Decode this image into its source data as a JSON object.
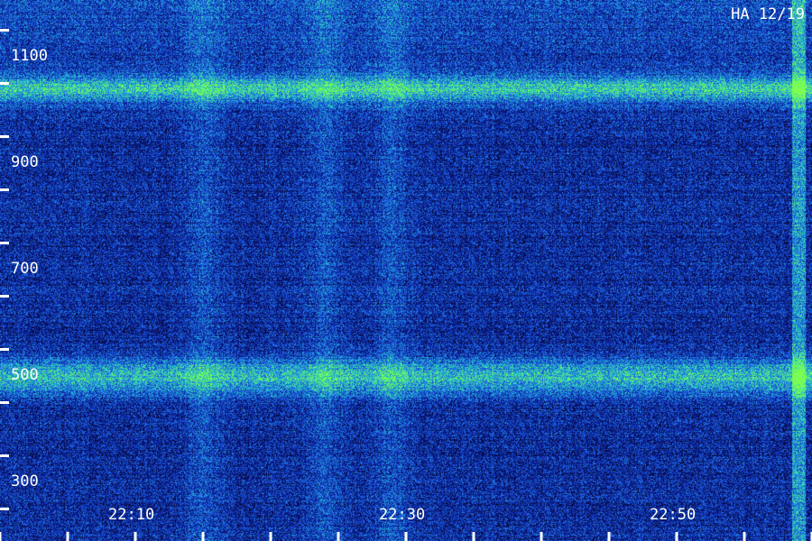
{
  "chart_data": {
    "type": "heatmap",
    "title": "HA 12/19",
    "xlabel": "",
    "ylabel": "",
    "x_ticks": [
      "22:10",
      "22:30",
      "22:50"
    ],
    "y_ticks": [
      300,
      500,
      700,
      900,
      1100
    ],
    "x_range_minutes": [
      0,
      59
    ],
    "y_range": [
      250,
      1160
    ],
    "bright_bands_y": [
      500,
      1040
    ],
    "bright_columns_time": [
      "22:15",
      "22:24",
      "22:29"
    ],
    "colormap": [
      "#06062a",
      "#0a1e9c",
      "#1e64e6",
      "#24c8c8",
      "#7cff50"
    ]
  }
}
